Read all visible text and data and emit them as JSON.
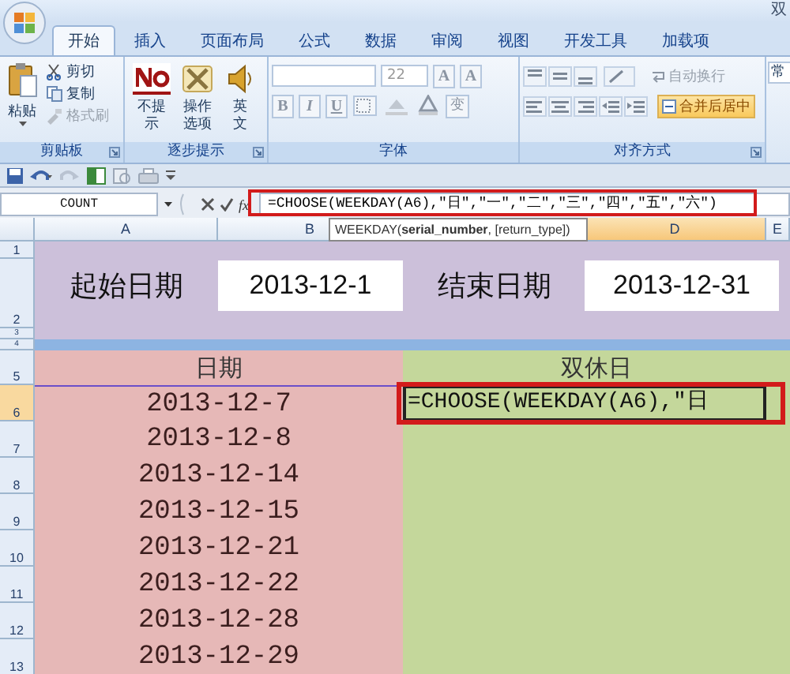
{
  "window": {
    "title": "双"
  },
  "ribbon": {
    "tabs": [
      {
        "label": "开始",
        "selected": true
      },
      {
        "label": "插入",
        "selected": false
      },
      {
        "label": "页面布局",
        "selected": false
      },
      {
        "label": "公式",
        "selected": false
      },
      {
        "label": "数据",
        "selected": false
      },
      {
        "label": "审阅",
        "selected": false
      },
      {
        "label": "视图",
        "selected": false
      },
      {
        "label": "开发工具",
        "selected": false
      },
      {
        "label": "加载项",
        "selected": false
      }
    ],
    "groups": [
      {
        "kind": "clipboard",
        "title": "剪贴板",
        "large": "粘贴",
        "small": [
          {
            "label": "剪切",
            "disabled": false
          },
          {
            "label": "复制",
            "disabled": false
          },
          {
            "label": "格式刷",
            "disabled": true
          }
        ]
      },
      {
        "kind": "hints",
        "title": "逐步提示",
        "buttons": [
          {
            "lines": [
              "不提",
              "示"
            ]
          },
          {
            "lines": [
              "操作",
              "选项"
            ]
          },
          {
            "lines": [
              "英",
              "文"
            ]
          }
        ]
      },
      {
        "kind": "font",
        "title": "字体",
        "font_size": "22",
        "size_buttons": [
          "A",
          "A"
        ],
        "format_buttons": [
          "B",
          "I",
          "U"
        ],
        "phonetic_button": "变"
      },
      {
        "kind": "alignment",
        "title": "对齐方式",
        "wrap_text": {
          "label": "自动换行",
          "disabled": true
        },
        "merge_center": {
          "label": "合并后居中",
          "on": true
        }
      },
      {
        "kind": "number",
        "number_format": "常"
      }
    ]
  },
  "formula_bar": {
    "name_box": "COUNT",
    "function_label": "fx",
    "formula": "=CHOOSE(WEEKDAY(A6),\"日\",\"一\",\"二\",\"三\",\"四\",\"五\",\"六\")"
  },
  "tooltip": "WEEKDAY(**serial_number**, [return_type])",
  "sheet": {
    "columns": [
      {
        "label": "A",
        "selected": false
      },
      {
        "label": "B",
        "selected": false
      },
      {
        "label": "D",
        "selected": true
      },
      {
        "label": "E",
        "selected": false
      }
    ],
    "rows": [
      {
        "label": "1",
        "selected": false
      },
      {
        "label": "2",
        "selected": false
      },
      {
        "label": "3",
        "selected": false
      },
      {
        "label": "4",
        "selected": false
      },
      {
        "label": "5",
        "selected": false
      },
      {
        "label": "6",
        "selected": true
      },
      {
        "label": "7",
        "selected": false
      },
      {
        "label": "8",
        "selected": false
      },
      {
        "label": "9",
        "selected": false
      },
      {
        "label": "10",
        "selected": false
      },
      {
        "label": "11",
        "selected": false
      },
      {
        "label": "12",
        "selected": false
      },
      {
        "label": "13",
        "selected": false
      }
    ],
    "start_label": "起始日期",
    "start_date": "2013-12-1",
    "end_label": "结束日期",
    "end_date": "2013-12-31",
    "date_header": "日期",
    "weekend_header": "双休日",
    "dates": [
      "2013-12-7",
      "2013-12-8",
      "2013-12-14",
      "2013-12-15",
      "2013-12-21",
      "2013-12-22",
      "2013-12-28",
      "2013-12-29"
    ],
    "editing_cell": "=CHOOSE(WEEKDAY(A6),\"日"
  }
}
